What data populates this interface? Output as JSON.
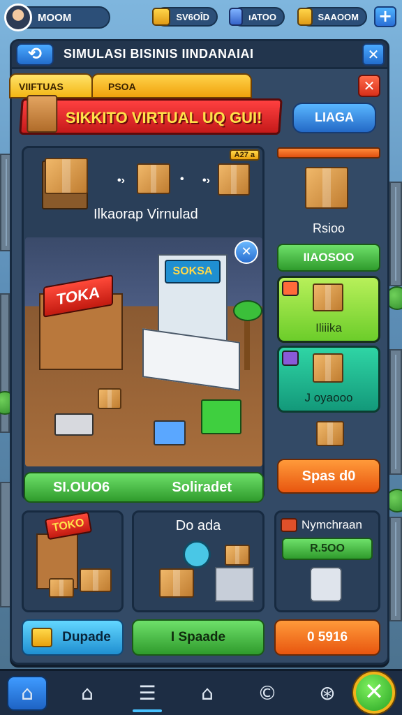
{
  "profile": {
    "name": "MOOM",
    "avatar_icon": "player-avatar"
  },
  "resources": [
    {
      "icon": "gold-box-icon",
      "value": "SV6OÎD"
    },
    {
      "icon": "blue-crate-icon",
      "value": "ıATOO"
    },
    {
      "icon": "gold-stack-icon",
      "value": "SAAOOM"
    }
  ],
  "header": {
    "back_icon": "arrow-back-icon",
    "title": "SIMULASI BISINIS IINDANAIAI",
    "close_icon": "close-icon"
  },
  "tabs": [
    {
      "label": "VIIFTUAS"
    },
    {
      "label": "PSOA"
    }
  ],
  "banner": {
    "text": "SIKKITO VIRTUAL UQ GUI!"
  },
  "action_button": {
    "label": "LIAGA"
  },
  "flow_card": {
    "badge": "A27 a",
    "caption": "Ilkaorap Virnulad"
  },
  "shop_scene": {
    "sign_left": "TOKA",
    "sign_right": "SOKSA",
    "info_icon": "close-circle-icon"
  },
  "shop_bar": {
    "left": "SI.OUO6",
    "right": "Soliradet"
  },
  "side": {
    "item_label": "Rsioo",
    "price_button": "IIAOSOO",
    "tile_green": "Iliiika",
    "tile_teal": "J oyaooo",
    "orange_button": "Spas d0"
  },
  "cards": {
    "store_sign": "TOKO",
    "middle_title": "Do ada",
    "right_title": "Nymchraan",
    "right_price": "R.5OO"
  },
  "bottom_buttons": {
    "left": "Dupade",
    "middle": "I Spaade",
    "right": "0 5916"
  },
  "nav": [
    {
      "icon": "home-icon"
    },
    {
      "icon": "house-outline-icon"
    },
    {
      "icon": "list-icon"
    },
    {
      "icon": "building-icon"
    },
    {
      "icon": "coin-icon"
    },
    {
      "icon": "chevron-badge-icon"
    }
  ],
  "fab_icon": "close-icon",
  "colors": {
    "accent": "#2b6fd6",
    "banner": "#d9301a",
    "success": "#2f9b2c",
    "warning": "#e8560f",
    "gold": "#f3b614"
  }
}
